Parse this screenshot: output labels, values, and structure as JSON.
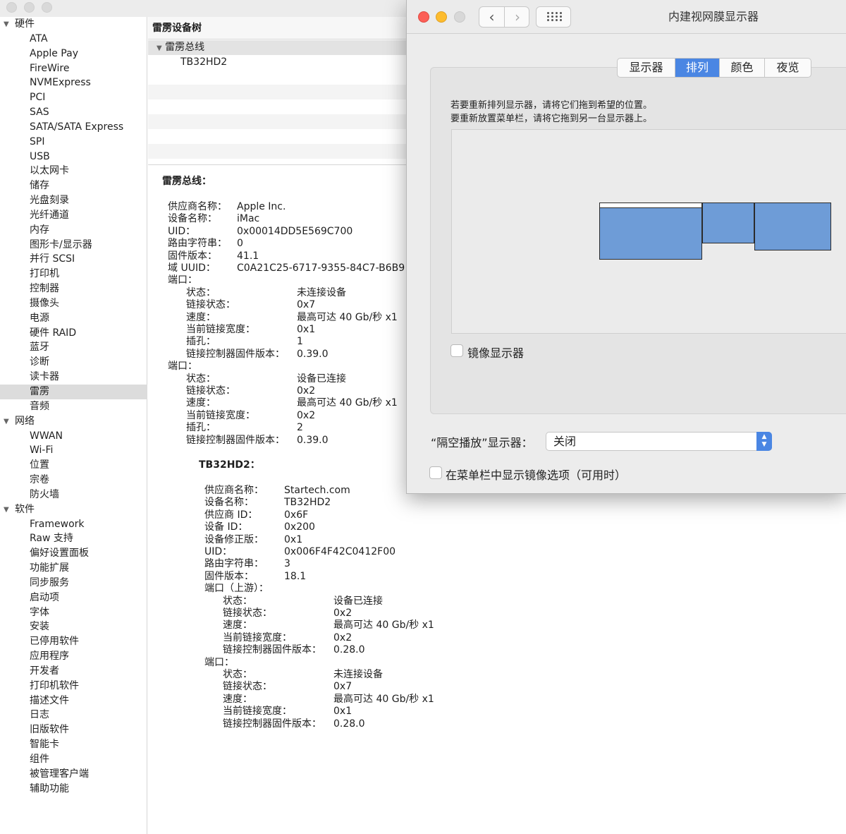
{
  "sidebar": {
    "sections": {
      "hardware": "硬件",
      "network": "网络",
      "software": "软件"
    },
    "hardware_items": [
      "ATA",
      "Apple Pay",
      "FireWire",
      "NVMExpress",
      "PCI",
      "SAS",
      "SATA/SATA Express",
      "SPI",
      "USB",
      "以太网卡",
      "储存",
      "光盘刻录",
      "光纤通道",
      "内存",
      "图形卡/显示器",
      "并行 SCSI",
      "打印机",
      "控制器",
      "摄像头",
      "电源",
      "硬件 RAID",
      "蓝牙",
      "诊断",
      "读卡器",
      "雷雳",
      "音频"
    ],
    "network_items": [
      "WWAN",
      "Wi-Fi",
      "位置",
      "宗卷",
      "防火墙"
    ],
    "software_items": [
      "Framework",
      "Raw 支持",
      "偏好设置面板",
      "功能扩展",
      "同步服务",
      "启动项",
      "字体",
      "安装",
      "已停用软件",
      "应用程序",
      "开发者",
      "打印机软件",
      "描述文件",
      "日志",
      "旧版软件",
      "智能卡",
      "组件",
      "被管理客户端",
      "辅助功能"
    ],
    "selected": "雷雳"
  },
  "tree": {
    "header": "雷雳设备树",
    "bus": "雷雳总线",
    "device": "TB32HD2"
  },
  "detail": {
    "bus_title": "雷雳总线：",
    "bus_fields": [
      [
        "供应商名称：",
        "Apple Inc."
      ],
      [
        "设备名称：",
        "iMac"
      ],
      [
        "UID：",
        "0x00014DD5E569C700"
      ],
      [
        "路由字符串：",
        "0"
      ],
      [
        "固件版本：",
        "41.1"
      ],
      [
        "域 UUID：",
        "C0A21C25-6717-9355-84C7-B6B9"
      ]
    ],
    "bus_ports": [
      {
        "label": "端口：",
        "fields": [
          [
            "状态：",
            "未连接设备"
          ],
          [
            "链接状态：",
            "0x7"
          ],
          [
            "速度：",
            "最高可达 40 Gb/秒 x1"
          ],
          [
            "当前链接宽度：",
            "0x1"
          ],
          [
            "插孔：",
            "1"
          ],
          [
            "链接控制器固件版本：",
            "0.39.0"
          ]
        ]
      },
      {
        "label": "端口：",
        "fields": [
          [
            "状态：",
            "设备已连接"
          ],
          [
            "链接状态：",
            "0x2"
          ],
          [
            "速度：",
            "最高可达 40 Gb/秒 x1"
          ],
          [
            "当前链接宽度：",
            "0x2"
          ],
          [
            "插孔：",
            "2"
          ],
          [
            "链接控制器固件版本：",
            "0.39.0"
          ]
        ]
      }
    ],
    "device_title": "TB32HD2：",
    "device_fields": [
      [
        "供应商名称：",
        "Startech.com"
      ],
      [
        "设备名称：",
        "TB32HD2"
      ],
      [
        "供应商 ID：",
        "0x6F"
      ],
      [
        "设备 ID：",
        "0x200"
      ],
      [
        "设备修正版：",
        "0x1"
      ],
      [
        "UID：",
        "0x006F4F42C0412F00"
      ],
      [
        "路由字符串：",
        "3"
      ],
      [
        "固件版本：",
        "18.1"
      ]
    ],
    "device_ports": [
      {
        "label": "端口（上游）：",
        "fields": [
          [
            "状态：",
            "设备已连接"
          ],
          [
            "链接状态：",
            "0x2"
          ],
          [
            "速度：",
            "最高可达 40 Gb/秒 x1"
          ],
          [
            "当前链接宽度：",
            "0x2"
          ],
          [
            "链接控制器固件版本：",
            "0.28.0"
          ]
        ]
      },
      {
        "label": "端口：",
        "fields": [
          [
            "状态：",
            "未连接设备"
          ],
          [
            "链接状态：",
            "0x7"
          ],
          [
            "速度：",
            "最高可达 40 Gb/秒 x1"
          ],
          [
            "当前链接宽度：",
            "0x1"
          ],
          [
            "链接控制器固件版本：",
            "0.28.0"
          ]
        ]
      }
    ]
  },
  "displays": {
    "title": "内建视网膜显示器",
    "tabs": [
      "显示器",
      "排列",
      "颜色",
      "夜览"
    ],
    "active_tab": "排列",
    "instruction_1": "若要重新排列显示器，请将它们拖到希望的位置。",
    "instruction_2": "要重新放置菜单栏，请将它拖到另一台显示器上。",
    "mirror_label": "镜像显示器",
    "mirror_checked": false,
    "airplay_label": "“隔空播放”显示器：",
    "airplay_value": "关闭",
    "menubar_option_label": "在菜单栏中显示镜像选项（可用时）",
    "menubar_option_checked": false,
    "accent_color": "#4a86e3",
    "monitor_color": "#6e9cd7"
  }
}
